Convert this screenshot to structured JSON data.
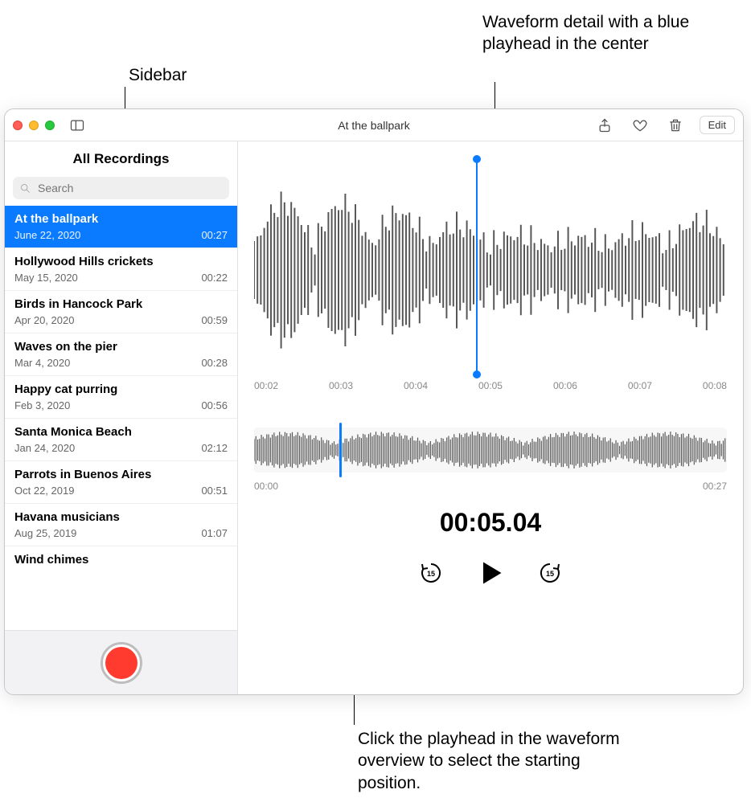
{
  "annotations": {
    "sidebar_label": "Sidebar",
    "detail_label": "Waveform detail with a blue playhead in the center",
    "overview_label": "Click the playhead in the waveform overview to select the starting position."
  },
  "toolbar": {
    "title": "At the ballpark",
    "edit_label": "Edit"
  },
  "sidebar": {
    "title": "All Recordings",
    "search_placeholder": "Search",
    "recordings": [
      {
        "title": "At the ballpark",
        "date": "June 22, 2020",
        "duration": "00:27",
        "selected": true
      },
      {
        "title": "Hollywood Hills crickets",
        "date": "May 15, 2020",
        "duration": "00:22",
        "selected": false
      },
      {
        "title": "Birds in Hancock Park",
        "date": "Apr 20, 2020",
        "duration": "00:59",
        "selected": false
      },
      {
        "title": "Waves on the pier",
        "date": "Mar 4, 2020",
        "duration": "00:28",
        "selected": false
      },
      {
        "title": "Happy cat purring",
        "date": "Feb 3, 2020",
        "duration": "00:56",
        "selected": false
      },
      {
        "title": "Santa Monica Beach",
        "date": "Jan 24, 2020",
        "duration": "02:12",
        "selected": false
      },
      {
        "title": "Parrots in Buenos Aires",
        "date": "Oct 22, 2019",
        "duration": "00:51",
        "selected": false
      },
      {
        "title": "Havana musicians",
        "date": "Aug 25, 2019",
        "duration": "01:07",
        "selected": false
      },
      {
        "title": "Wind chimes",
        "date": "",
        "duration": "",
        "selected": false
      }
    ]
  },
  "detail": {
    "ruler": [
      "00:02",
      "00:03",
      "00:04",
      "00:05",
      "00:06",
      "00:07",
      "00:08"
    ]
  },
  "overview": {
    "start": "00:00",
    "end": "00:27"
  },
  "playback": {
    "time": "00:05.04",
    "skip_seconds": "15"
  }
}
